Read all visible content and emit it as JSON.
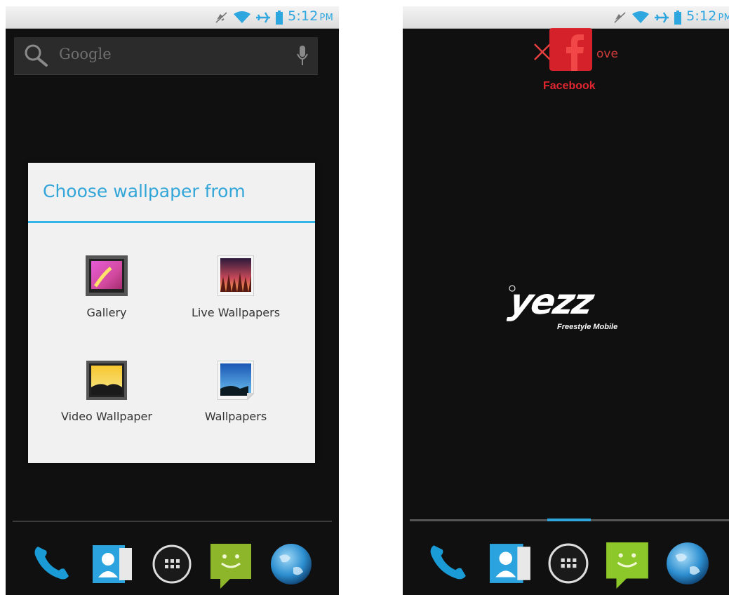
{
  "status": {
    "time": "5:12",
    "ampm": "PM"
  },
  "search": {
    "label": "Google"
  },
  "dialog": {
    "title": "Choose wallpaper from",
    "options": [
      {
        "label": "Gallery",
        "icon": "gallery-icon"
      },
      {
        "label": "Live Wallpapers",
        "icon": "live-wallpapers-icon"
      },
      {
        "label": "Video Wallpaper",
        "icon": "video-wallpaper-icon"
      },
      {
        "label": "Wallpapers",
        "icon": "wallpapers-icon"
      }
    ]
  },
  "drag": {
    "remove_label": "ove",
    "app_label": "Facebook"
  },
  "logo": {
    "brand": "yezz",
    "tagline": "Freestyle Mobile"
  },
  "dock": [
    "phone-icon",
    "contacts-icon",
    "app-drawer-icon",
    "messaging-icon",
    "browser-icon"
  ],
  "colors": {
    "accent": "#33b5e5",
    "remove": "#e02630"
  }
}
